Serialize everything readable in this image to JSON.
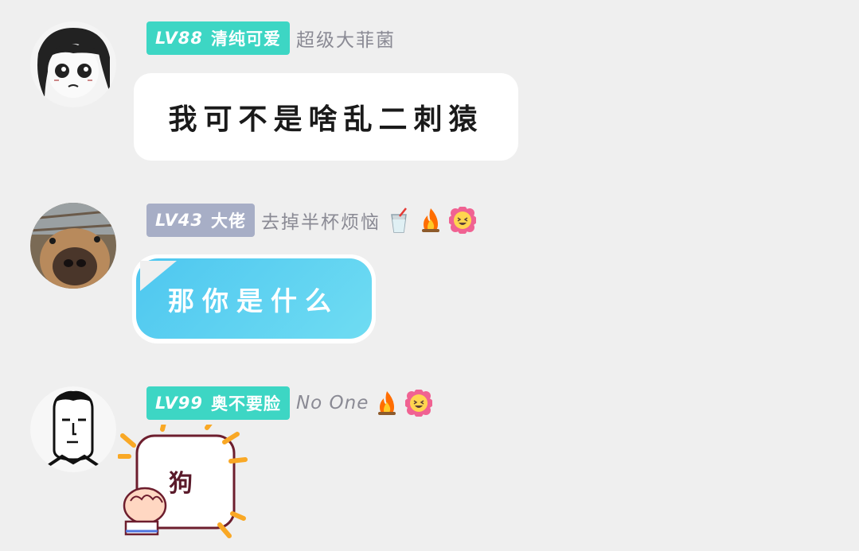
{
  "messages": [
    {
      "level": "LV88",
      "nickname": "清纯可爱",
      "tagline": "超级大菲菌",
      "text": "我可不是啥乱二刺猿"
    },
    {
      "level": "LV43",
      "nickname": "大佬",
      "tagline": "去掉半杯烦恼",
      "tagline_icons": [
        "cup-icon",
        "fire-icon",
        "flower-smile-icon"
      ],
      "text": "那你是什么"
    },
    {
      "level": "LV99",
      "nickname": "奥不要脸",
      "tagline": "No One",
      "tagline_icons": [
        "fire-icon",
        "flower-smile-icon"
      ],
      "sticker_text": "狗"
    }
  ],
  "colors": {
    "background": "#efefef",
    "badge_teal": "#3dd6c4",
    "badge_grey": "#a7aec6",
    "bubble_blue": "#4ec7f0"
  }
}
